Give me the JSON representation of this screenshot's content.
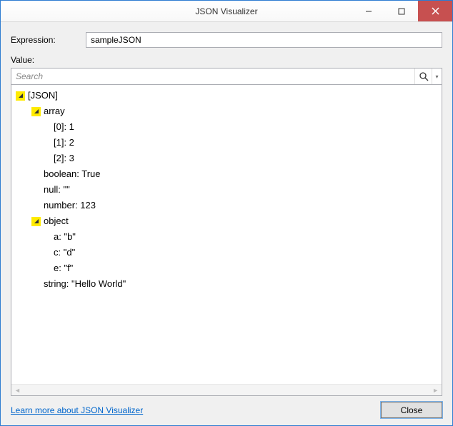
{
  "window": {
    "title": "JSON Visualizer"
  },
  "labels": {
    "expression": "Expression:",
    "value": "Value:"
  },
  "expression": {
    "value": "sampleJSON"
  },
  "search": {
    "placeholder": "Search"
  },
  "tree": {
    "root": "[JSON]",
    "items": {
      "array_label": "array",
      "array_0": "[0]: 1",
      "array_1": "[1]: 2",
      "array_2": "[2]: 3",
      "boolean": "boolean: True",
      "null": "null: \"\"",
      "number": "number: 123",
      "object_label": "object",
      "object_a": "a: \"b\"",
      "object_c": "c: \"d\"",
      "object_e": "e: \"f\"",
      "string": "string: \"Hello World\""
    }
  },
  "footer": {
    "help": "Learn more about JSON Visualizer",
    "close": "Close"
  }
}
